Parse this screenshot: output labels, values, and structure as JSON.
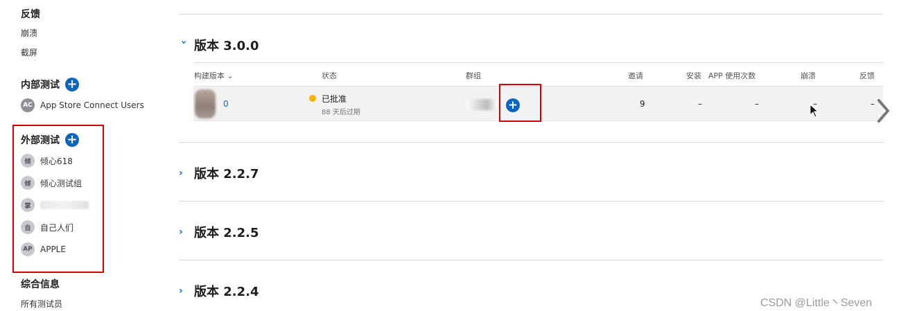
{
  "sidebar": {
    "feedback": {
      "title": "反馈",
      "items": [
        "崩溃",
        "截屏"
      ]
    },
    "internal": {
      "title": "内部测试",
      "groups": [
        {
          "badge": "AC",
          "label": "App Store Connect Users"
        }
      ]
    },
    "external": {
      "title": "外部测试",
      "groups": [
        {
          "badge": "倾",
          "label": "倾心618"
        },
        {
          "badge": "倾",
          "label": "倾心测试组"
        },
        {
          "badge": "掌",
          "label": ""
        },
        {
          "badge": "自",
          "label": "自己人们"
        },
        {
          "badge": "AP",
          "label": "APPLE"
        }
      ]
    },
    "info": {
      "title": "综合信息",
      "items": [
        "所有测试员"
      ]
    }
  },
  "versions": [
    {
      "title": "版本 3.0.0",
      "expanded": true
    },
    {
      "title": "版本 2.2.7",
      "expanded": false
    },
    {
      "title": "版本 2.2.5",
      "expanded": false
    },
    {
      "title": "版本 2.2.4",
      "expanded": false
    }
  ],
  "table": {
    "headers": {
      "build": "构建版本",
      "status": "状态",
      "groups": "群组",
      "invites": "邀请",
      "installs": "安装",
      "sessions": "APP 使用次数",
      "crashes": "崩溃",
      "feedback": "反馈"
    },
    "row": {
      "build": "0",
      "status": "已批准",
      "expiry": "88 天后过期",
      "invites": "9",
      "installs": "–",
      "sessions": "–",
      "crashes": "–",
      "feedback": "–"
    }
  },
  "colors": {
    "accent": "#0a66c2",
    "highlight": "#d60000",
    "status": "#f5b400"
  },
  "watermark": "CSDN @Little丶Seven"
}
